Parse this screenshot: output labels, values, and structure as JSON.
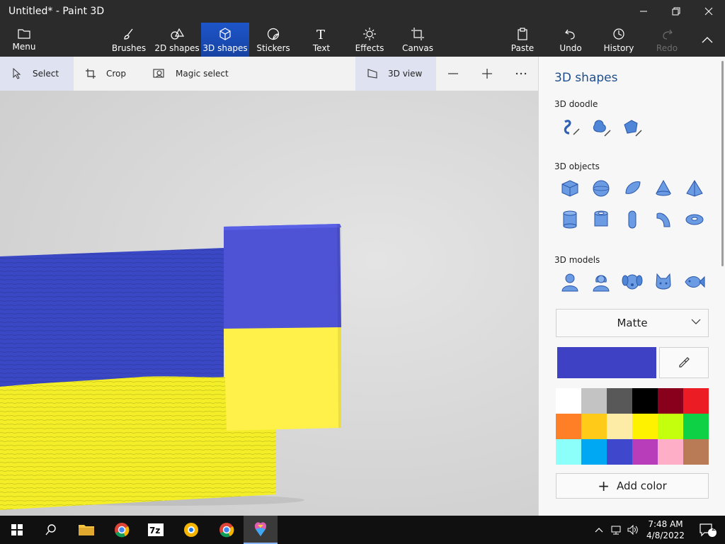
{
  "window": {
    "title": "Untitled* - Paint 3D",
    "controls": {
      "minimize": "minimize",
      "maximize": "maximize",
      "close": "close"
    }
  },
  "ribbon": {
    "menu": "Menu",
    "tools": [
      {
        "label": "Brushes",
        "icon": "brush-icon"
      },
      {
        "label": "2D shapes",
        "icon": "2d-shapes-icon"
      },
      {
        "label": "3D shapes",
        "icon": "3d-shapes-icon",
        "active": true
      },
      {
        "label": "Stickers",
        "icon": "stickers-icon"
      },
      {
        "label": "Text",
        "icon": "text-icon"
      },
      {
        "label": "Effects",
        "icon": "effects-icon"
      },
      {
        "label": "Canvas",
        "icon": "canvas-icon"
      }
    ],
    "actions": [
      {
        "label": "Paste",
        "icon": "paste-icon"
      },
      {
        "label": "Undo",
        "icon": "undo-icon"
      },
      {
        "label": "History",
        "icon": "history-icon"
      },
      {
        "label": "Redo",
        "icon": "redo-icon",
        "disabled": true
      }
    ]
  },
  "subtoolbar": {
    "select": "Select",
    "crop": "Crop",
    "magic_select": "Magic select",
    "view_3d": "3D view"
  },
  "panel": {
    "title": "3D shapes",
    "sections": {
      "doodle": "3D doodle",
      "objects": "3D objects",
      "models": "3D models"
    },
    "material": "Matte",
    "current_color": "#3f41c4",
    "palette": [
      "#ffffff",
      "#c3c3c3",
      "#585858",
      "#000000",
      "#88001b",
      "#ec1c24",
      "#ff7f27",
      "#ffca18",
      "#fdeca6",
      "#fff200",
      "#c4ff0e",
      "#0ed145",
      "#8cfffb",
      "#00a8f3",
      "#3f48cc",
      "#b83dba",
      "#ffaec8",
      "#b97a56"
    ],
    "add_color": "Add color"
  },
  "taskbar": {
    "time": "7:48 AM",
    "date": "4/8/2022",
    "notifications": "2"
  }
}
